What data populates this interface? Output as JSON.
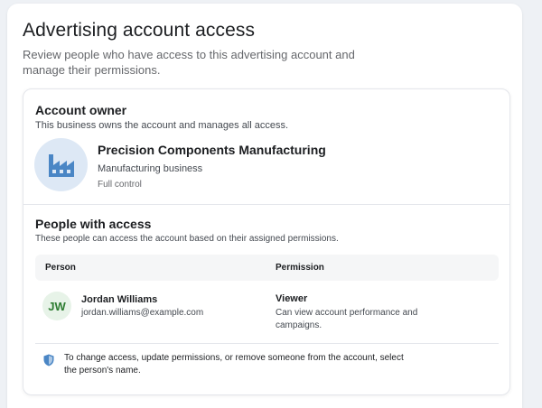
{
  "header": {
    "title": "Advertising account access",
    "description": "Review people who have access to this advertising account and manage their permissions."
  },
  "owner": {
    "section_title": "Account owner",
    "section_desc": "This business owns the account and manages all access.",
    "avatar_icon": "factory-icon",
    "name": "Precision Components Manufacturing",
    "type": "Manufacturing business",
    "role": "Full control"
  },
  "people": {
    "section_title": "People with access",
    "section_desc": "These people can access the account based on their assigned permissions.",
    "columns": {
      "person": "Person",
      "permission": "Permission"
    },
    "rows": [
      {
        "initials": "JW",
        "name": "Jordan Williams",
        "email": "jordan.williams@example.com",
        "permission": "Viewer",
        "permission_desc": "Can view account performance and campaigns."
      }
    ],
    "notice": "To change access, update permissions, or remove someone from the account, select the person's name.",
    "notice_icon": "shield-icon"
  },
  "colors": {
    "accent": "#4a86c5",
    "avatar_green": "#2e7d32"
  }
}
